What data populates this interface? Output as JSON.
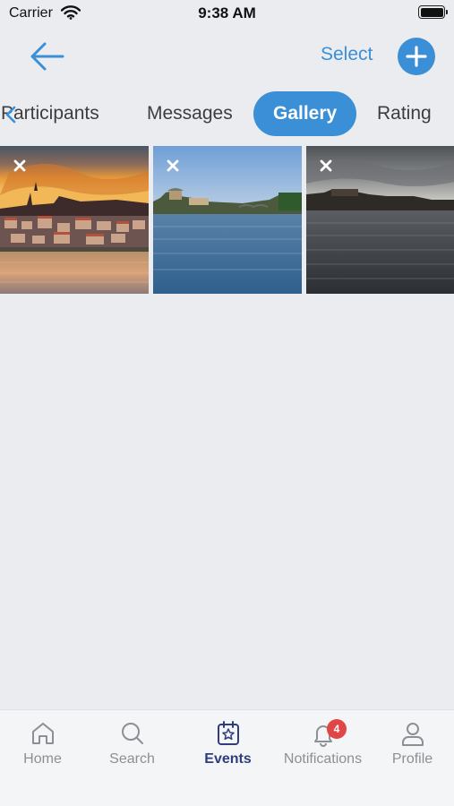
{
  "status_bar": {
    "carrier": "Carrier",
    "time": "9:38 AM",
    "battery_level": 1.0
  },
  "header": {
    "back_icon": "arrow-left-icon",
    "select_label": "Select",
    "add_icon": "plus-icon",
    "accent_color": "#3a8fd6"
  },
  "tabs": [
    {
      "label": "Participants",
      "active": false
    },
    {
      "label": "Messages",
      "active": false
    },
    {
      "label": "Gallery",
      "active": true
    },
    {
      "label": "Rating",
      "active": false
    }
  ],
  "gallery": {
    "photos": [
      {
        "subject": "city at sunset by river",
        "remove_icon": "close-icon"
      },
      {
        "subject": "river with bridge, blue sky",
        "remove_icon": "close-icon"
      },
      {
        "subject": "river at dusk, cloudy sky",
        "remove_icon": "close-icon"
      }
    ]
  },
  "tabbar": {
    "items": [
      {
        "label": "Home",
        "icon": "home-icon",
        "active": false
      },
      {
        "label": "Search",
        "icon": "search-icon",
        "active": false
      },
      {
        "label": "Events",
        "icon": "calendar-star-icon",
        "active": true
      },
      {
        "label": "Notifications",
        "icon": "bell-icon",
        "active": false,
        "badge": "4"
      },
      {
        "label": "Profile",
        "icon": "person-icon",
        "active": false
      }
    ],
    "active_color": "#2f3d7c",
    "badge_color": "#e24545"
  }
}
